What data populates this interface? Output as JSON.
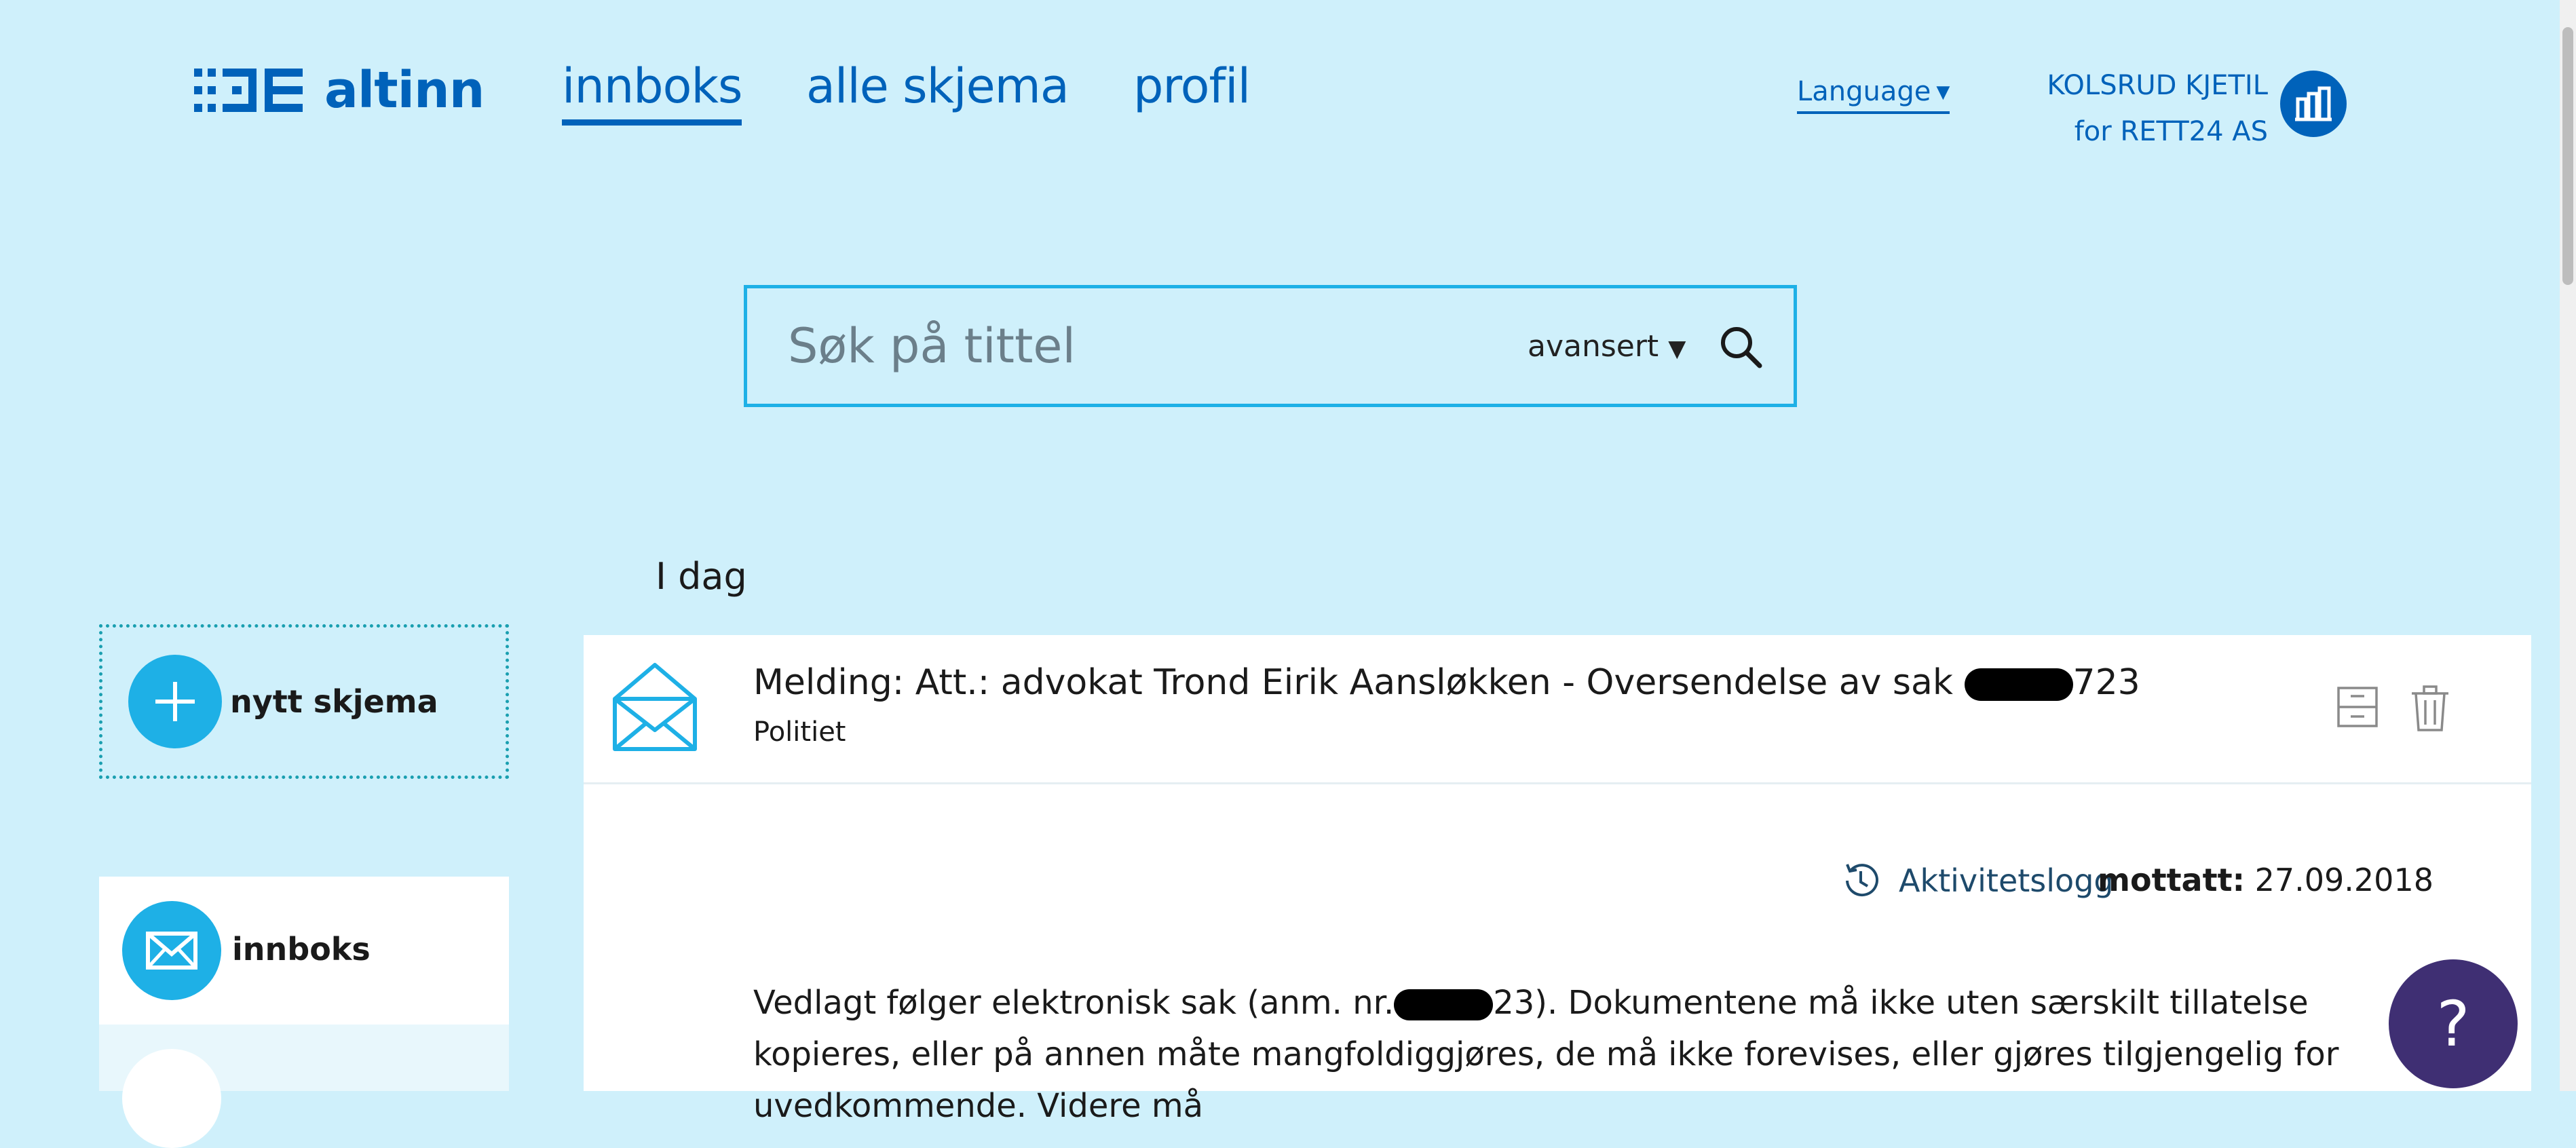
{
  "header": {
    "logo_text": "altinn",
    "nav": [
      {
        "label": "innboks",
        "active": true
      },
      {
        "label": "alle skjema",
        "active": false
      },
      {
        "label": "profil",
        "active": false
      }
    ],
    "language_label": "Language",
    "profile": {
      "name": "KOLSRUD KJETIL",
      "org": "for RETT24 AS"
    }
  },
  "search": {
    "placeholder": "Søk på tittel",
    "advanced_label": "avansert"
  },
  "sidebar": {
    "new_form_label": "nytt skjema",
    "items": [
      {
        "label": "innboks"
      }
    ]
  },
  "section": {
    "label": "I dag"
  },
  "message": {
    "title_prefix": "Melding: Att.: advokat Trond Eirik Aansløkken - Oversendelse av sak ",
    "title_suffix": "723",
    "sender": "Politiet",
    "activity_label": "Aktivitetslogg",
    "received_label": "mottatt:",
    "received_date": "27.09.2018",
    "body_prefix": "Vedlagt følger elektronisk sak (anm. nr.",
    "body_suffix": "23). Dokumentene må ikke uten særskilt tillatelse kopieres, eller på annen måte mangfoldiggjøres, de må ikke forevises, eller gjøres tilgjengelig for uvedkommende. Videre må"
  },
  "help": {
    "label": "?"
  },
  "colors": {
    "brand": "#0062ba",
    "accent": "#1eb0e6",
    "background": "#cff0fb",
    "help": "#3f2f73"
  }
}
